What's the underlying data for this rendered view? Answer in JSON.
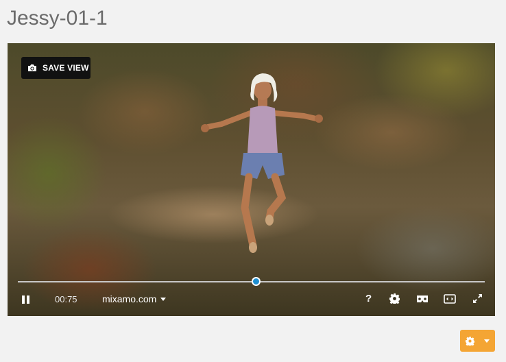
{
  "page": {
    "title": "Jessy-01-1"
  },
  "viewer": {
    "save_view_label": "SAVE VIEW",
    "time": "00:75",
    "source_label": "mixamo.com",
    "help_label": "?",
    "playback_progress": 0.51,
    "accent_color": "#1f8fd1"
  },
  "options_button": {
    "color": "#f4a534",
    "icon": "gear-icon"
  }
}
